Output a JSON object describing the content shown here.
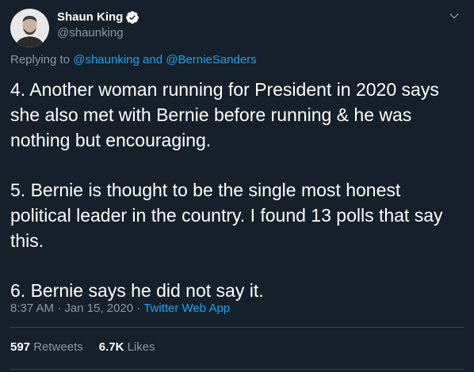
{
  "author": {
    "name": "Shaun King",
    "handle": "@shaunking",
    "verified": true
  },
  "reply": {
    "prefix": "Replying to ",
    "mention1": "@shaunking",
    "joiner": " and ",
    "mention2": "@BernieSanders"
  },
  "tweet": {
    "paragraphs": [
      "4. Another woman running for President in 2020 says she also met with Bernie before running & he was nothing but encouraging.",
      "5. Bernie is thought to be the single most honest political leader in the country. I found 13 polls that say this.",
      "6. Bernie says he did not say it."
    ]
  },
  "meta": {
    "time": "8:37 AM",
    "sep1": " · ",
    "date": "Jan 15, 2020",
    "sep2": " · ",
    "source": "Twitter Web App"
  },
  "stats": {
    "retweets_count": "597",
    "retweets_label": "Retweets",
    "likes_count": "6.7K",
    "likes_label": "Likes"
  },
  "colors": {
    "background": "#15202b",
    "accent": "#1da1f2",
    "muted": "#8899a6",
    "divider": "#38444d"
  },
  "icons": {
    "verified": "verified-badge-icon",
    "caret": "chevron-down-icon"
  }
}
